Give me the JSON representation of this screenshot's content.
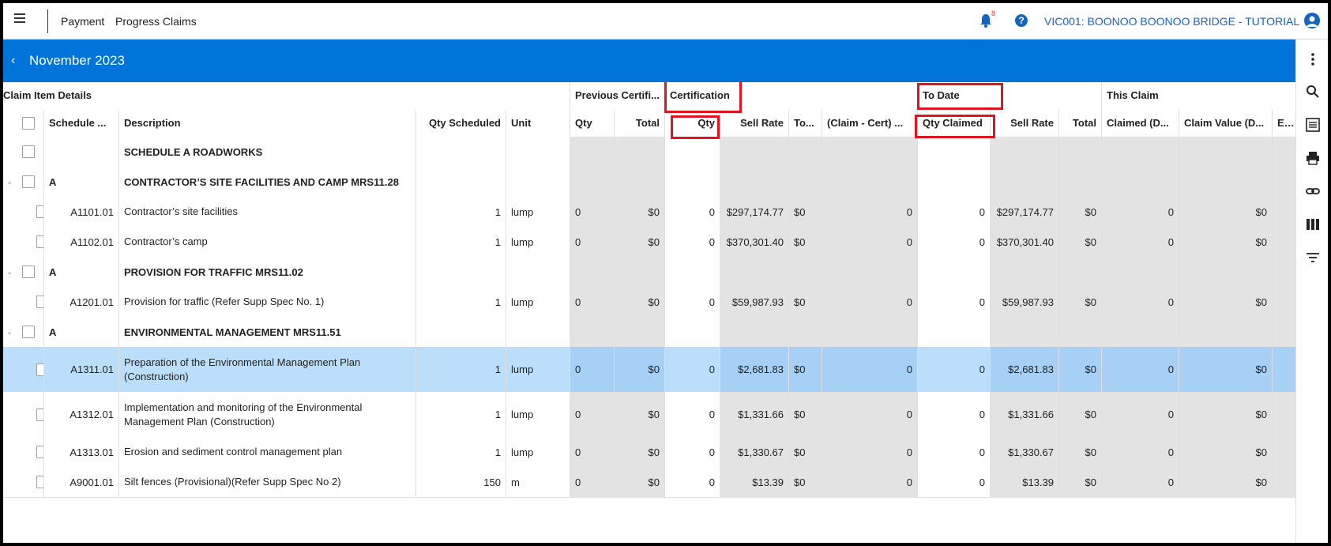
{
  "topbar": {
    "crumb_1": "Payment",
    "crumb_2": "Progress Claims",
    "notification_count": "8",
    "help_label": "?",
    "project": "VIC001: BOONOO BOONOO BRIDGE - TUTORIAL"
  },
  "header": {
    "back": "‹",
    "period": "November 2023"
  },
  "groups": {
    "claim_item": "Claim Item Details",
    "previous": "Previous Certifi...",
    "certification": "Certification",
    "to_date": "To Date",
    "this_claim": "This Claim"
  },
  "columns": {
    "schedule": "Schedule ...",
    "description": "Description",
    "qty_scheduled": "Qty Scheduled",
    "unit": "Unit",
    "prev_qty": "Qty",
    "prev_total": "Total",
    "cert_qty": "Qty",
    "cert_sell_rate": "Sell Rate",
    "cert_total": "To...",
    "claim_minus_cert": "(Claim - Cert) ...",
    "qty_claimed": "Qty Claimed",
    "td_sell_rate": "Sell Rate",
    "td_total": "Total",
    "claimed_d": "Claimed (D...",
    "claim_value": "Claim Value (D...",
    "earned": "Ear"
  },
  "rows": [
    {
      "type": "group",
      "schedule": "",
      "desc": "SCHEDULE A ROADWORKS"
    },
    {
      "type": "group",
      "schedule": "A",
      "desc": "CONTRACTOR’S SITE FACILITIES AND CAMP MRS11.28"
    },
    {
      "type": "item",
      "schedule": "A1101.01",
      "desc": "Contractor’s site facilities",
      "qty_sched": "1",
      "unit": "lump",
      "prev_qty": "0",
      "prev_total": "$0",
      "cert_qty": "0",
      "cert_rate": "$297,174.77",
      "cert_total": "$0",
      "diff": "0",
      "qty_claimed": "0",
      "td_rate": "$297,174.77",
      "td_total": "$0",
      "claimed_d": "0",
      "claim_value": "$0"
    },
    {
      "type": "item",
      "schedule": "A1102.01",
      "desc": "Contractor’s camp",
      "qty_sched": "1",
      "unit": "lump",
      "prev_qty": "0",
      "prev_total": "$0",
      "cert_qty": "0",
      "cert_rate": "$370,301.40",
      "cert_total": "$0",
      "diff": "0",
      "qty_claimed": "0",
      "td_rate": "$370,301.40",
      "td_total": "$0",
      "claimed_d": "0",
      "claim_value": "$0"
    },
    {
      "type": "group",
      "schedule": "A",
      "desc": "PROVISION FOR TRAFFIC MRS11.02"
    },
    {
      "type": "item",
      "schedule": "A1201.01",
      "desc": "Provision for traffic (Refer Supp Spec No. 1)",
      "qty_sched": "1",
      "unit": "lump",
      "prev_qty": "0",
      "prev_total": "$0",
      "cert_qty": "0",
      "cert_rate": "$59,987.93",
      "cert_total": "$0",
      "diff": "0",
      "qty_claimed": "0",
      "td_rate": "$59,987.93",
      "td_total": "$0",
      "claimed_d": "0",
      "claim_value": "$0"
    },
    {
      "type": "group",
      "schedule": "A",
      "desc": "ENVIRONMENTAL MANAGEMENT MRS11.51"
    },
    {
      "type": "item",
      "schedule": "A1311.01",
      "desc": "Preparation of the Environmental Management Plan (Construction)",
      "qty_sched": "1",
      "unit": "lump",
      "prev_qty": "0",
      "prev_total": "$0",
      "cert_qty": "0",
      "cert_rate": "$2,681.83",
      "cert_total": "$0",
      "diff": "0",
      "qty_claimed": "0",
      "td_rate": "$2,681.83",
      "td_total": "$0",
      "claimed_d": "0",
      "claim_value": "$0",
      "selected": true
    },
    {
      "type": "item",
      "schedule": "A1312.01",
      "desc": "Implementation and monitoring of the Environmental Management Plan (Construction)",
      "qty_sched": "1",
      "unit": "lump",
      "prev_qty": "0",
      "prev_total": "$0",
      "cert_qty": "0",
      "cert_rate": "$1,331.66",
      "cert_total": "$0",
      "diff": "0",
      "qty_claimed": "0",
      "td_rate": "$1,331.66",
      "td_total": "$0",
      "claimed_d": "0",
      "claim_value": "$0"
    },
    {
      "type": "item",
      "schedule": "A1313.01",
      "desc": "Erosion and sediment control management plan",
      "qty_sched": "1",
      "unit": "lump",
      "prev_qty": "0",
      "prev_total": "$0",
      "cert_qty": "0",
      "cert_rate": "$1,330.67",
      "cert_total": "$0",
      "diff": "0",
      "qty_claimed": "0",
      "td_rate": "$1,330.67",
      "td_total": "$0",
      "claimed_d": "0",
      "claim_value": "$0"
    },
    {
      "type": "item",
      "schedule": "A9001.01",
      "desc": "Silt fences (Provisional)(Refer Supp Spec No 2)",
      "qty_sched": "150",
      "unit": "m",
      "prev_qty": "0",
      "prev_total": "$0",
      "cert_qty": "0",
      "cert_rate": "$13.39",
      "cert_total": "$0",
      "diff": "0",
      "qty_claimed": "0",
      "td_rate": "$13.39",
      "td_total": "$0",
      "claimed_d": "0",
      "claim_value": "$0"
    }
  ]
}
